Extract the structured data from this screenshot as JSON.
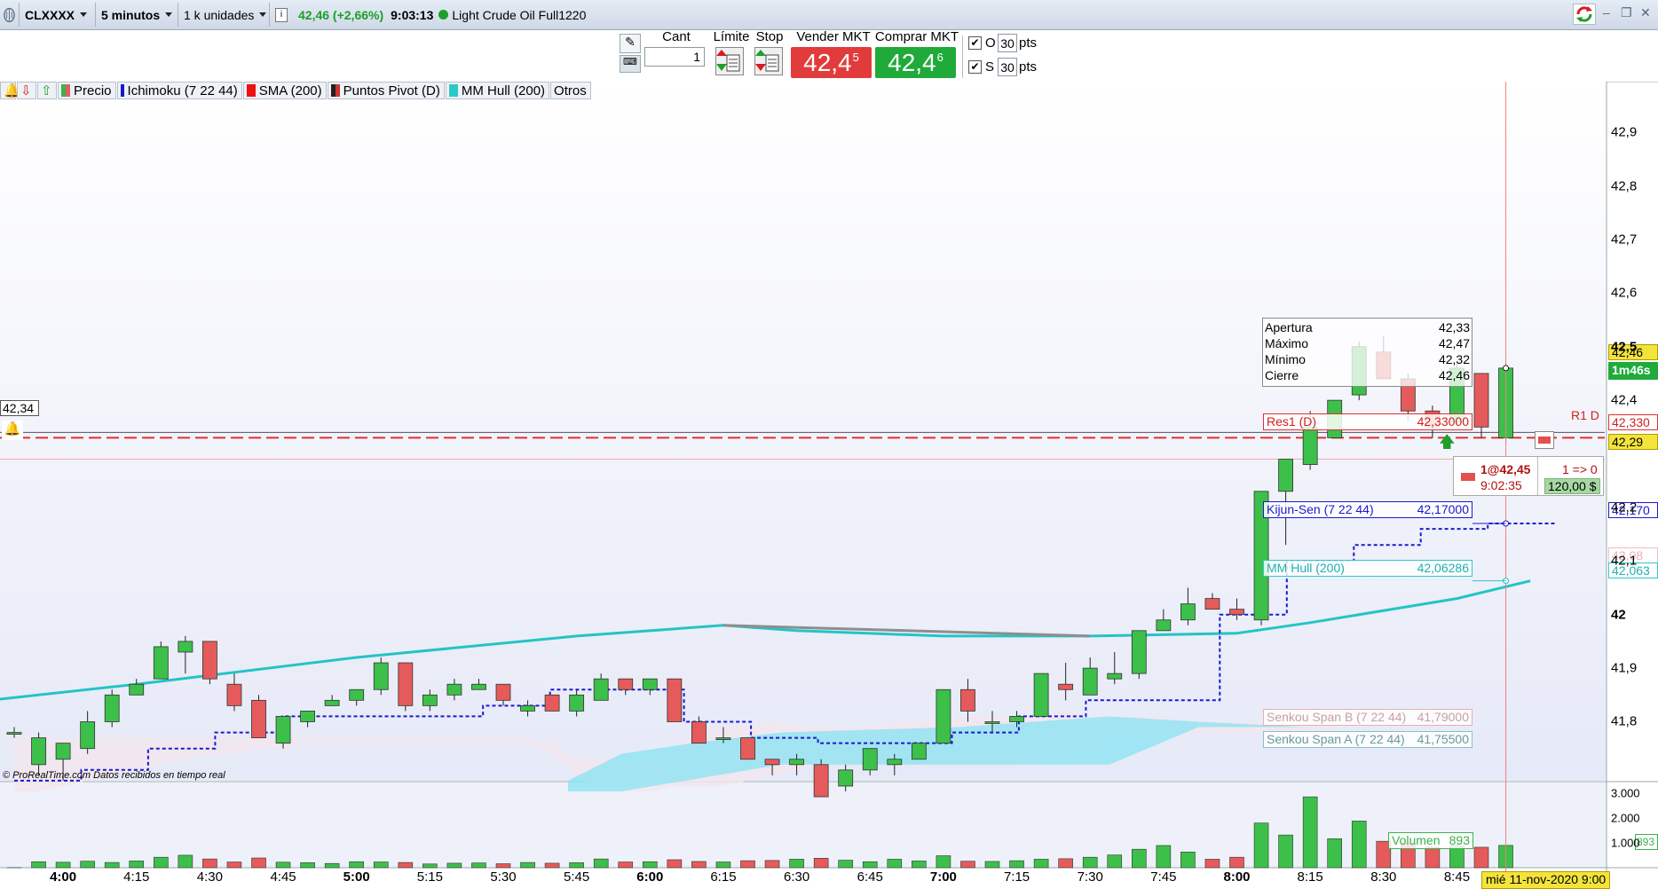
{
  "titlebar": {
    "symbol": "CLXXXX",
    "timeframe": "5 minutos",
    "units": "1 k unidades",
    "info_icon": "info-icon",
    "quote": "42,46 (+2,66%)",
    "time": "9:03:13",
    "instrument": "Light Crude Oil Full1220",
    "status_color": "#1e9e2a"
  },
  "orderbar": {
    "qty_label": "Cant",
    "qty_value": "1",
    "limit_label": "Límite",
    "stop_label": "Stop",
    "sell_label": "Vender MKT",
    "sell_price": "42,4",
    "sell_price_sup": "5",
    "buy_label": "Comprar MKT",
    "buy_price": "42,4",
    "buy_price_sup": "6",
    "o_label": "O",
    "o_value": "30",
    "s_label": "S",
    "s_value": "30",
    "pts": "pts",
    "sell_color": "#e23b3b",
    "buy_color": "#1faa3a"
  },
  "indicators": [
    {
      "label": "Precio",
      "color": "#3cb34a"
    },
    {
      "label": "Ichimoku (7 22 44)",
      "color": "#1a1acc"
    },
    {
      "label": "SMA (200)",
      "color": "#ee1111"
    },
    {
      "label": "Puntos Pivot (D)",
      "color": "#222222"
    },
    {
      "label": "MM Hull (200)",
      "color": "#2fc8c8"
    },
    {
      "label": "Otros",
      "color": ""
    }
  ],
  "ohlc": {
    "open_label": "Apertura",
    "open": "42,33",
    "high_label": "Máximo",
    "high": "42,47",
    "low_label": "Mínimo",
    "low": "42,32",
    "close_label": "Cierre",
    "close": "42,46"
  },
  "tags": {
    "res1_label": "Res1 (D)",
    "res1_value": "42,33000",
    "kijun_label": "Kijun-Sen (7 22 44)",
    "kijun_value": "42,17000",
    "hull_label": "MM Hull (200)",
    "hull_value": "42,06286",
    "spanb_label": "Senkou Span B (7 22 44)",
    "spanb_value": "41,79000",
    "spana_label": "Senkou Span A (7 22 44)",
    "spana_value": "41,75500",
    "volume_label": "Volumen",
    "volume_value": "893",
    "r1_marker": "R1 D"
  },
  "price_axis": {
    "current": "42,46",
    "countdown": "1m46s",
    "res1": "42,330",
    "alert": "42,29",
    "kijun": "42,170",
    "hull": "42,063",
    "hidden_value": "42,08",
    "crosshair_left": "42,34",
    "vol_current": "893"
  },
  "order": {
    "text": "1@42,45",
    "time": "9:02:35",
    "position": "1 => 0",
    "pnl": "120,00 $"
  },
  "footer": {
    "credit": "© ProRealTime.com",
    "realtime": "Datos recibidos en tiempo real",
    "date": "mié 11-nov-2020 9:00"
  },
  "chart_data": {
    "type": "candlestick",
    "y_ticks": [
      "42,9",
      "42,8",
      "42,7",
      "42,6",
      "42,5",
      "42,4",
      "42,2",
      "42,1",
      "42",
      "41,9",
      "41,8"
    ],
    "y_range": [
      41.67,
      42.94
    ],
    "vol_ticks": [
      "3.000",
      "2.000",
      "1.000"
    ],
    "x_ticks": [
      "4:00",
      "4:15",
      "4:30",
      "4:45",
      "5:00",
      "5:15",
      "5:30",
      "5:45",
      "6:00",
      "6:15",
      "6:30",
      "6:45",
      "7:00",
      "7:15",
      "7:30",
      "7:45",
      "8:00",
      "8:15",
      "8:30",
      "8:45"
    ],
    "x_bold": [
      "4:00",
      "5:00",
      "6:00",
      "7:00",
      "8:00"
    ],
    "first_time": "3:50",
    "interval_minutes": 5,
    "ohlc": [
      [
        41.78,
        41.79,
        41.77,
        41.78
      ],
      [
        41.72,
        41.78,
        41.7,
        41.77
      ],
      [
        41.73,
        41.75,
        41.69,
        41.76
      ],
      [
        41.75,
        41.82,
        41.74,
        41.8
      ],
      [
        41.8,
        41.86,
        41.79,
        41.85
      ],
      [
        41.85,
        41.88,
        41.85,
        41.87
      ],
      [
        41.88,
        41.95,
        41.89,
        41.94
      ],
      [
        41.93,
        41.96,
        41.89,
        41.95
      ],
      [
        41.95,
        41.95,
        41.87,
        41.88
      ],
      [
        41.87,
        41.89,
        41.82,
        41.83
      ],
      [
        41.84,
        41.85,
        41.77,
        41.77
      ],
      [
        41.76,
        41.81,
        41.75,
        41.81
      ],
      [
        41.8,
        41.82,
        41.79,
        41.82
      ],
      [
        41.83,
        41.85,
        41.83,
        41.84
      ],
      [
        41.84,
        41.86,
        41.83,
        41.86
      ],
      [
        41.86,
        41.92,
        41.85,
        41.91
      ],
      [
        41.91,
        41.91,
        41.82,
        41.83
      ],
      [
        41.83,
        41.86,
        41.82,
        41.85
      ],
      [
        41.85,
        41.88,
        41.84,
        41.87
      ],
      [
        41.86,
        41.88,
        41.86,
        41.87
      ],
      [
        41.87,
        41.87,
        41.83,
        41.84
      ],
      [
        41.82,
        41.84,
        41.81,
        41.83
      ],
      [
        41.85,
        41.84,
        41.82,
        41.82
      ],
      [
        41.82,
        41.86,
        41.81,
        41.85
      ],
      [
        41.84,
        41.89,
        41.84,
        41.88
      ],
      [
        41.88,
        41.88,
        41.85,
        41.86
      ],
      [
        41.86,
        41.88,
        41.85,
        41.88
      ],
      [
        41.88,
        41.88,
        41.8,
        41.8
      ],
      [
        41.8,
        41.81,
        41.76,
        41.76
      ],
      [
        41.77,
        41.79,
        41.76,
        41.77
      ],
      [
        41.77,
        41.77,
        41.73,
        41.73
      ],
      [
        41.73,
        41.73,
        41.7,
        41.72
      ],
      [
        41.72,
        41.74,
        41.7,
        41.73
      ],
      [
        41.72,
        41.73,
        41.66,
        41.66
      ],
      [
        41.68,
        41.72,
        41.67,
        41.71
      ],
      [
        41.71,
        41.73,
        41.7,
        41.75
      ],
      [
        41.72,
        41.74,
        41.7,
        41.73
      ],
      [
        41.73,
        41.76,
        41.73,
        41.76
      ],
      [
        41.76,
        41.86,
        41.76,
        41.86
      ],
      [
        41.86,
        41.88,
        41.8,
        41.82
      ],
      [
        41.8,
        41.82,
        41.78,
        41.8
      ],
      [
        41.8,
        41.82,
        41.79,
        41.81
      ],
      [
        41.81,
        41.89,
        41.81,
        41.89
      ],
      [
        41.87,
        41.91,
        41.84,
        41.86
      ],
      [
        41.85,
        41.92,
        41.86,
        41.9
      ],
      [
        41.88,
        41.93,
        41.87,
        41.89
      ],
      [
        41.89,
        41.97,
        41.88,
        41.97
      ],
      [
        41.97,
        42.01,
        41.97,
        41.99
      ],
      [
        41.99,
        42.05,
        41.98,
        42.02
      ],
      [
        42.03,
        42.04,
        42.02,
        42.01
      ],
      [
        42.01,
        42.03,
        41.99,
        42.0
      ],
      [
        41.99,
        42.23,
        41.98,
        42.23
      ],
      [
        42.23,
        42.24,
        42.13,
        42.29
      ],
      [
        42.28,
        42.38,
        42.27,
        42.35
      ],
      [
        42.33,
        42.4,
        42.33,
        42.4
      ],
      [
        42.41,
        42.51,
        42.4,
        42.5
      ],
      [
        42.49,
        42.52,
        42.44,
        42.44
      ],
      [
        42.44,
        42.45,
        42.36,
        42.38
      ],
      [
        42.38,
        42.39,
        42.33,
        42.35
      ],
      [
        42.36,
        42.47,
        42.35,
        42.46
      ],
      [
        42.45,
        42.45,
        42.33,
        42.35
      ],
      [
        42.33,
        42.47,
        42.32,
        42.46
      ]
    ],
    "volume": [
      3,
      240,
      220,
      260,
      210,
      270,
      420,
      500,
      350,
      230,
      390,
      220,
      200,
      170,
      240,
      230,
      210,
      150,
      180,
      190,
      160,
      210,
      180,
      200,
      350,
      230,
      240,
      320,
      250,
      230,
      280,
      290,
      340,
      380,
      300,
      240,
      340,
      270,
      480,
      260,
      250,
      280,
      340,
      360,
      420,
      510,
      740,
      890,
      630,
      340,
      420,
      1790,
      1310,
      2840,
      1160,
      1870,
      1060,
      980,
      820,
      893,
      820,
      893
    ],
    "hull": [
      41.84,
      41.87,
      41.92,
      41.96,
      41.98,
      41.97,
      41.96,
      41.96,
      41.965,
      41.985,
      42.03,
      42.063
    ],
    "hull_x": [
      "3:45",
      "4:15",
      "5:00",
      "5:45",
      "6:15",
      "6:30",
      "7:00",
      "7:30",
      "8:00",
      "8:15",
      "8:45",
      "9:00"
    ],
    "kijun_levels": [
      41.69,
      41.71,
      41.75,
      41.78,
      41.81,
      41.81,
      41.81,
      41.83,
      41.86,
      41.86,
      41.8,
      41.77,
      41.76,
      41.76,
      41.78,
      41.81,
      41.84,
      41.84,
      42.0,
      42.1,
      42.13,
      42.16,
      42.17
    ]
  }
}
